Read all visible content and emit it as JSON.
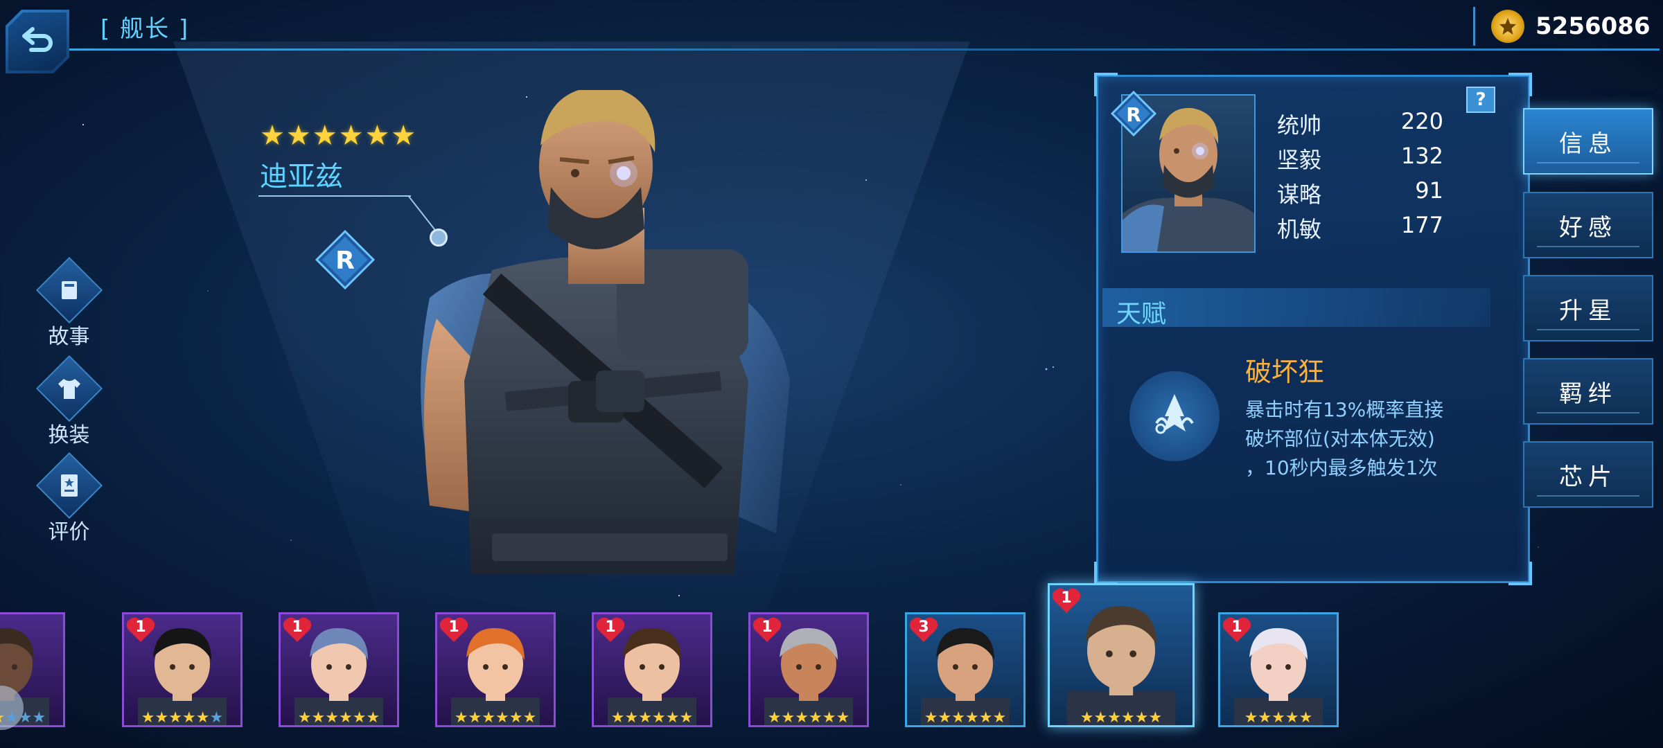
{
  "header": {
    "title": "[ 舰长 ]",
    "coins": "5256086"
  },
  "hero": {
    "name": "迪亚兹",
    "stars": 6,
    "rank": "R"
  },
  "left_menu": [
    {
      "label": "故事",
      "icon": "book-icon"
    },
    {
      "label": "换装",
      "icon": "shirt-icon"
    },
    {
      "label": "评价",
      "icon": "review-card-icon"
    }
  ],
  "info_panel": {
    "rank": "R",
    "help": "?",
    "stats": [
      {
        "label": "统帅",
        "value": "220"
      },
      {
        "label": "坚毅",
        "value": "132"
      },
      {
        "label": "谋略",
        "value": "91"
      },
      {
        "label": "机敏",
        "value": "177"
      }
    ],
    "talent_title": "天赋",
    "skill_name": "破坏狂",
    "skill_desc_lines": [
      "暴击时有13%概率直接",
      "破坏部位(对本体无效)",
      "，10秒内最多触发1次"
    ]
  },
  "tabs": [
    {
      "label": "信息",
      "active": true
    },
    {
      "label": "好感",
      "active": false
    },
    {
      "label": "升星",
      "active": false
    },
    {
      "label": "羁绊",
      "active": false
    },
    {
      "label": "芯片",
      "active": false
    }
  ],
  "roster": [
    {
      "badge": "",
      "stars": 3,
      "dim_stars": 3,
      "frame": "purple",
      "face": "dark-hood"
    },
    {
      "badge": "1",
      "stars": 5,
      "dim_stars": 1,
      "frame": "purple",
      "face": "black-hair"
    },
    {
      "badge": "1",
      "stars": 6,
      "dim_stars": 0,
      "frame": "purple",
      "face": "glasses-woman"
    },
    {
      "badge": "1",
      "stars": 6,
      "dim_stars": 0,
      "frame": "purple",
      "face": "orange-hair"
    },
    {
      "badge": "1",
      "stars": 6,
      "dim_stars": 0,
      "frame": "purple",
      "face": "brown-hair-glasses"
    },
    {
      "badge": "1",
      "stars": 6,
      "dim_stars": 0,
      "frame": "purple",
      "face": "goggles-grin"
    },
    {
      "badge": "3",
      "stars": 6,
      "dim_stars": 0,
      "frame": "blue",
      "face": "mustache-man"
    },
    {
      "badge": "1",
      "stars": 6,
      "dim_stars": 0,
      "frame": "blue",
      "face": "hat-old-man",
      "selected": true
    },
    {
      "badge": "1",
      "stars": 5,
      "dim_stars": 0,
      "frame": "blue",
      "face": "white-hair-woman"
    }
  ],
  "colors": {
    "accent": "#5ed3ff",
    "gold": "#ffd33d",
    "skill_name": "#ffb23a",
    "panel_border": "#2e8ad0"
  }
}
